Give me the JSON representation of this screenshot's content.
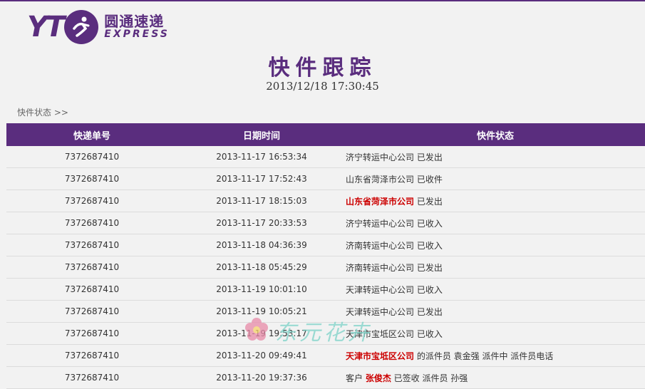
{
  "brand": {
    "logo_mark": "YT",
    "name_cn": "圆通速递",
    "name_en": "EXPRESS",
    "accent_color": "#5a2d7e",
    "highlight_color": "#c00000"
  },
  "page": {
    "title": "快件跟踪",
    "timestamp": "2013/12/18 17:30:45",
    "section_label": "快件状态 >>"
  },
  "table": {
    "headers": [
      "快递单号",
      "日期时间",
      "快件状态"
    ],
    "rows": [
      {
        "no": "7372687410",
        "datetime": "2013-11-17 16:53:34",
        "status": [
          {
            "t": "济宁转运中心公司 已发出",
            "h": false
          }
        ]
      },
      {
        "no": "7372687410",
        "datetime": "2013-11-17 17:52:43",
        "status": [
          {
            "t": "山东省菏泽市公司 已收件",
            "h": false
          }
        ]
      },
      {
        "no": "7372687410",
        "datetime": "2013-11-17 18:15:03",
        "status": [
          {
            "t": "山东省菏泽市公司",
            "h": true
          },
          {
            "t": " 已发出",
            "h": false
          }
        ]
      },
      {
        "no": "7372687410",
        "datetime": "2013-11-17 20:33:53",
        "status": [
          {
            "t": "济宁转运中心公司 已收入",
            "h": false
          }
        ]
      },
      {
        "no": "7372687410",
        "datetime": "2013-11-18 04:36:39",
        "status": [
          {
            "t": "济南转运中心公司 已收入",
            "h": false
          }
        ]
      },
      {
        "no": "7372687410",
        "datetime": "2013-11-18 05:45:29",
        "status": [
          {
            "t": "济南转运中心公司 已发出",
            "h": false
          }
        ]
      },
      {
        "no": "7372687410",
        "datetime": "2013-11-19 10:01:10",
        "status": [
          {
            "t": "天津转运中心公司 已收入",
            "h": false
          }
        ]
      },
      {
        "no": "7372687410",
        "datetime": "2013-11-19 10:05:21",
        "status": [
          {
            "t": "天津转运中心公司 已发出",
            "h": false
          }
        ]
      },
      {
        "no": "7372687410",
        "datetime": "2013-11-19 19:53:17",
        "status": [
          {
            "t": "天津市宝坻区公司 已收入",
            "h": false
          }
        ]
      },
      {
        "no": "7372687410",
        "datetime": "2013-11-20 09:49:41",
        "status": [
          {
            "t": "天津市宝坻区公司",
            "h": true
          },
          {
            "t": " 的派件员 袁金强 派件中 派件员电话",
            "h": false
          }
        ]
      },
      {
        "no": "7372687410",
        "datetime": "2013-11-20 19:37:36",
        "status": [
          {
            "t": "客户 ",
            "h": false
          },
          {
            "t": "张俊杰",
            "h": true
          },
          {
            "t": " 已签收 派件员 孙强",
            "h": false
          }
        ]
      }
    ]
  },
  "watermark": {
    "text": "东元花卉",
    "icon": "flower-icon"
  }
}
